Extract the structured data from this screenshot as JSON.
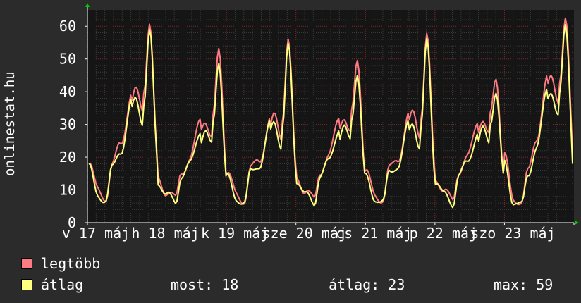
{
  "site": "onlinestat.hu",
  "legend": [
    {
      "label": "legtöbb",
      "color": "#ff7b82"
    },
    {
      "label": "átlag",
      "color": "#ffff80"
    }
  ],
  "stats": {
    "most": "most: 18",
    "atlag": "átlag: 23",
    "max": "max: 59"
  },
  "chart_data": {
    "type": "line",
    "ylabel": "onlinestat.hu",
    "ylim": [
      0,
      65
    ],
    "yticks": [
      0,
      10,
      20,
      30,
      40,
      50,
      60
    ],
    "grid": true,
    "x_ticks": [
      "v 17 máj",
      "h 18 máj",
      "k 19 máj",
      "sze 20 máj",
      "cs 21 máj",
      "p 22 máj",
      "szo 23 máj"
    ],
    "points_per_day": 48,
    "series": [
      {
        "name": "legtöbb",
        "color": "#ff7b82",
        "day_peaks": [
          62,
          52,
          57,
          49,
          58,
          44,
          62
        ],
        "day_troughs": [
          8,
          7,
          7,
          7,
          7,
          7,
          6
        ],
        "day_shoulders": [
          40,
          32,
          32,
          33,
          33,
          32,
          44
        ],
        "last": 21
      },
      {
        "name": "átlag",
        "color": "#ffff80",
        "day_peaks": [
          59,
          49,
          54,
          46,
          55,
          41,
          59
        ],
        "day_troughs": [
          7,
          6,
          6,
          6,
          6,
          6,
          5
        ],
        "day_shoulders": [
          37,
          29,
          30,
          30,
          30,
          29,
          40
        ],
        "last": 18
      }
    ]
  }
}
